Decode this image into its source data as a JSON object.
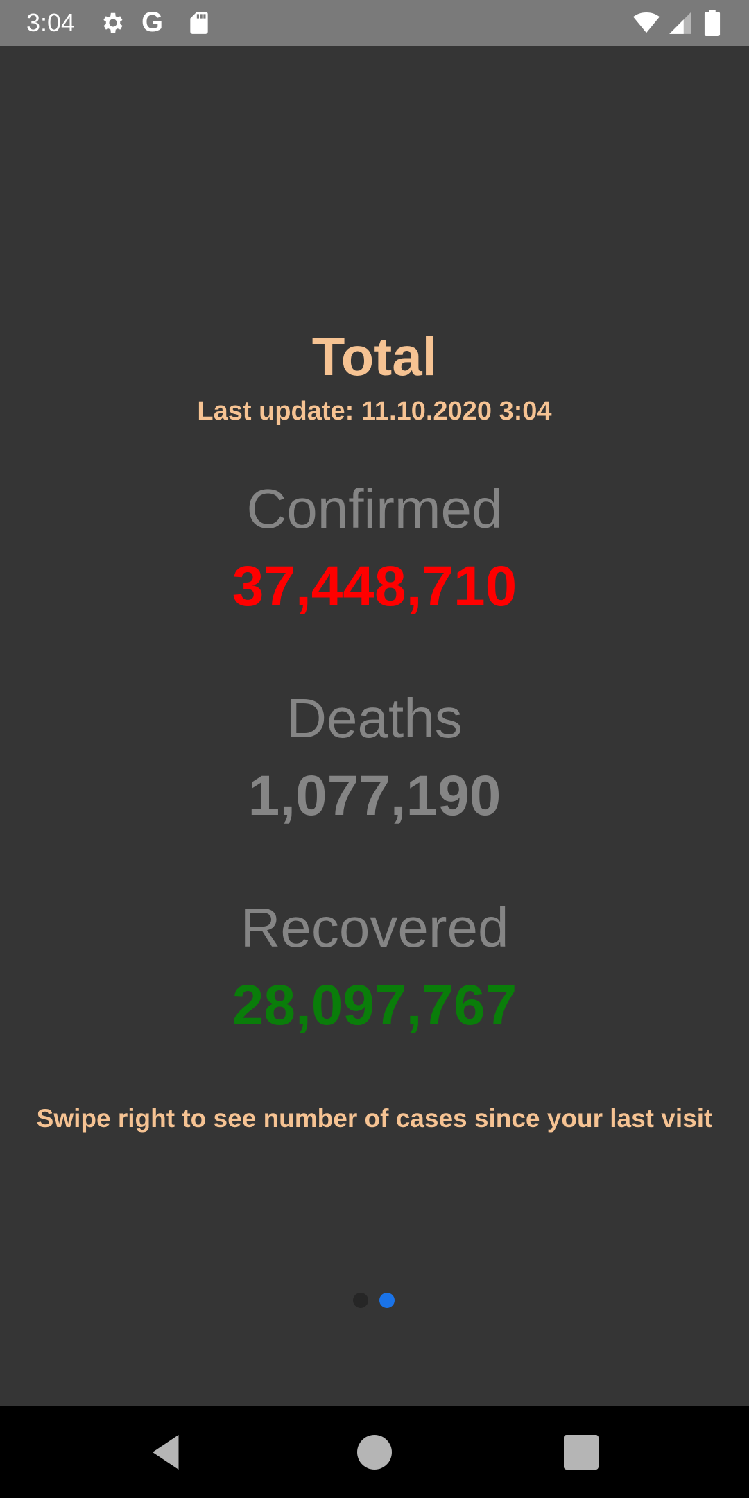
{
  "status_bar": {
    "time": "3:04",
    "google_letter": "G",
    "icons": [
      "gear-icon",
      "google-icon",
      "sd-card-icon",
      "wifi-icon",
      "cell-signal-icon",
      "battery-icon"
    ],
    "background_color": "#7a7a7a"
  },
  "main": {
    "title": "Total",
    "last_update": "Last update: 11.10.2020 3:04",
    "stats": [
      {
        "label": "Confirmed",
        "value": "37,448,710",
        "color": "#ff0000"
      },
      {
        "label": "Deaths",
        "value": "1,077,190",
        "color": "#858585"
      },
      {
        "label": "Recovered",
        "value": "28,097,767",
        "color": "#0a7d0a"
      }
    ],
    "hint": "Swipe right to see number of cases since your last visit",
    "accent_color": "#f6c393"
  },
  "pager": {
    "page_count": 2,
    "active_index": 1,
    "active_color": "#1a73e8",
    "inactive_color": "#262626"
  },
  "nav_bar": {
    "icons": [
      "back-icon",
      "home-icon",
      "recents-icon"
    ]
  }
}
